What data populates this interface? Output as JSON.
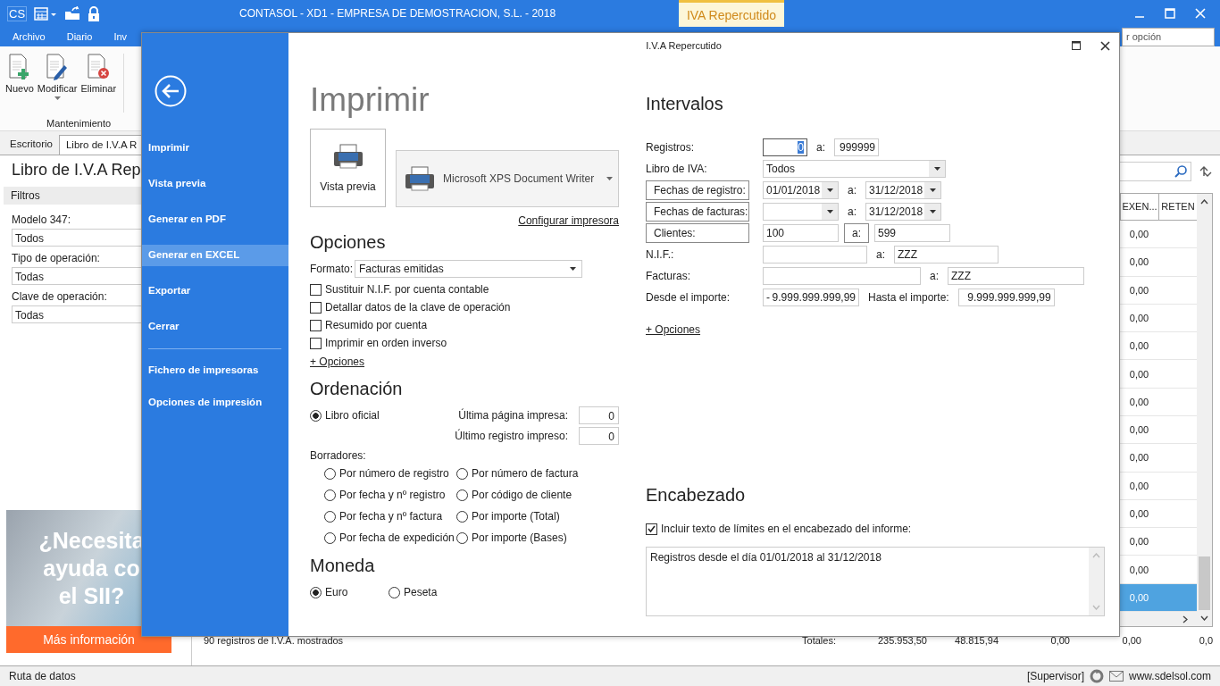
{
  "app": {
    "logo": "CS",
    "title": "CONTASOL - XD1 - EMPRESA DE DEMOSTRACION, S.L. - 2018",
    "context_tab": "IVA Repercutido",
    "search": {
      "placeholder": "r opción"
    }
  },
  "menu": [
    "Archivo",
    "Diario",
    "Inv"
  ],
  "ribbon": {
    "buttons": [
      {
        "label": "Nuevo",
        "kind": "new"
      },
      {
        "label": "Modificar",
        "kind": "edit"
      },
      {
        "label": "Eliminar",
        "kind": "delete"
      }
    ],
    "group": "Mantenimiento"
  },
  "doc_tabs": [
    {
      "label": "Escritorio",
      "selected": false
    },
    {
      "label": "Libro de I.V.A R",
      "selected": true
    }
  ],
  "page_title": "Libro de I.V.A Rep",
  "filters": {
    "heading": "Filtros",
    "fields": [
      {
        "label": "Modelo 347:",
        "value": "Todos"
      },
      {
        "label": "Tipo de operación:",
        "value": "Todas"
      },
      {
        "label": "Clave de operación:",
        "value": "Todas"
      }
    ]
  },
  "promo": {
    "headline": [
      "¿Necesita",
      "ayuda co",
      "el SII?"
    ],
    "button": "Más información"
  },
  "grid": {
    "columns": [
      "EXEN...",
      "RETEN"
    ],
    "rows": [
      {
        "value": "0,00",
        "selected": false
      },
      {
        "value": "0,00",
        "selected": false
      },
      {
        "value": "0,00",
        "selected": false
      },
      {
        "value": "0,00",
        "selected": false
      },
      {
        "value": "0,00",
        "selected": false
      },
      {
        "value": "0,00",
        "selected": false
      },
      {
        "value": "0,00",
        "selected": false
      },
      {
        "value": "0,00",
        "selected": false
      },
      {
        "value": "0,00",
        "selected": false
      },
      {
        "value": "0,00",
        "selected": false
      },
      {
        "value": "0,00",
        "selected": false
      },
      {
        "value": "0,00",
        "selected": false
      },
      {
        "value": "0,00",
        "selected": false
      },
      {
        "value": "0,00",
        "selected": true
      }
    ],
    "summary": "90 registros de I.V.A. mostrados",
    "totals_label": "Totales:",
    "totals": [
      "235.953,50",
      "48.815,94",
      "0,00",
      "0,00",
      "0,0"
    ]
  },
  "status_bar": {
    "left": "Ruta de datos",
    "user": "[Supervisor]",
    "website": "www.sdelsol.com"
  },
  "dialog": {
    "title": "I.V.A Repercutido",
    "menu": [
      {
        "label": "Imprimir",
        "selected": false
      },
      {
        "label": "Vista previa",
        "selected": false
      },
      {
        "label": "Generar en PDF",
        "selected": false
      },
      {
        "label": "Generar en EXCEL",
        "selected": true
      },
      {
        "label": "Exportar",
        "selected": false
      },
      {
        "label": "Cerrar",
        "selected": false
      }
    ],
    "menu_secondary": [
      {
        "label": "Fichero de impresoras",
        "selected": false
      },
      {
        "label": "Opciones de impresión",
        "selected": false
      }
    ],
    "print": {
      "heading": "Imprimir",
      "preview_button": "Vista previa",
      "printer": "Microsoft XPS Document Writer",
      "configure_link": "Configurar impresora"
    },
    "options": {
      "heading": "Opciones",
      "format_label": "Formato:",
      "format": "Facturas emitidas",
      "checkboxes": [
        {
          "label": "Sustituir N.I.F. por cuenta contable",
          "checked": false
        },
        {
          "label": "Detallar datos de la clave de operación",
          "checked": false
        },
        {
          "label": "Resumido por cuenta",
          "checked": false
        },
        {
          "label": "Imprimir en orden inverso",
          "checked": false
        }
      ],
      "more_link": "+ Opciones"
    },
    "ordering": {
      "heading": "Ordenación",
      "official": {
        "label": "Libro oficial",
        "selected": true
      },
      "last_page_label": "Última página impresa:",
      "last_page": "0",
      "last_record_label": "Último registro impreso:",
      "last_record": "0",
      "drafts_label": "Borradores:",
      "drafts": [
        {
          "label": "Por número de registro",
          "selected": false
        },
        {
          "label": "Por número de factura",
          "selected": false
        },
        {
          "label": "Por fecha y nº registro",
          "selected": false
        },
        {
          "label": "Por código de cliente",
          "selected": false
        },
        {
          "label": "Por fecha y nº factura",
          "selected": false
        },
        {
          "label": "Por importe (Total)",
          "selected": false
        },
        {
          "label": "Por fecha de expedición",
          "selected": false
        },
        {
          "label": "Por importe (Bases)",
          "selected": false
        }
      ]
    },
    "currency": {
      "heading": "Moneda",
      "options": [
        {
          "label": "Euro",
          "selected": true
        },
        {
          "label": "Peseta",
          "selected": false
        }
      ]
    },
    "intervals": {
      "heading": "Intervalos",
      "rows": [
        {
          "label": "Registros:",
          "label_button": false,
          "from": {
            "kind": "number",
            "value": "0",
            "focused": true
          },
          "sep": {
            "kind": "text",
            "text": "a:"
          },
          "to": {
            "kind": "number",
            "value": "999999"
          }
        },
        {
          "label": "Libro de IVA:",
          "label_button": false,
          "from": {
            "kind": "select",
            "value": "Todos"
          }
        },
        {
          "label": "Fechas de registro:",
          "label_button": true,
          "from": {
            "kind": "date",
            "value": "01/01/2018"
          },
          "sep": {
            "kind": "text",
            "text": "a:"
          },
          "to": {
            "kind": "date",
            "value": "31/12/2018"
          }
        },
        {
          "label": "Fechas de facturas:",
          "label_button": true,
          "from": {
            "kind": "date"
          },
          "sep": {
            "kind": "text",
            "text": "a:"
          },
          "to": {
            "kind": "date",
            "value": "31/12/2018"
          }
        },
        {
          "label": "Clientes:",
          "label_button": true,
          "from": {
            "kind": "code",
            "value": "100"
          },
          "sep": {
            "kind": "button",
            "text": "a:"
          },
          "to": {
            "kind": "code",
            "value": "599"
          }
        },
        {
          "label": "N.I.F.:",
          "label_button": false,
          "from": {
            "kind": "nif"
          },
          "sep": {
            "kind": "text",
            "text": "a:"
          },
          "to": {
            "kind": "nif",
            "value": "ZZZ"
          }
        },
        {
          "label": "Facturas:",
          "label_button": false,
          "from": {
            "kind": "invoice"
          },
          "sep": {
            "kind": "text",
            "text": "a:"
          },
          "to": {
            "kind": "invoice_to",
            "value": "ZZZ"
          }
        },
        {
          "label": "Desde el importe:",
          "label_button": false,
          "from": {
            "kind": "amount",
            "sign": "-",
            "value": "9.999.999.999,99"
          },
          "sep": {
            "kind": "text",
            "text": "Hasta el importe:"
          },
          "to": {
            "kind": "amount",
            "value": "9.999.999.999,99"
          }
        }
      ],
      "more_link": "+ Opciones"
    },
    "header": {
      "heading": "Encabezado",
      "checkbox": {
        "label": "Incluir texto de límites en el encabezado del informe:",
        "checked": true
      },
      "text": "Registros desde el día 01/01/2018 al 31/12/2018"
    }
  }
}
